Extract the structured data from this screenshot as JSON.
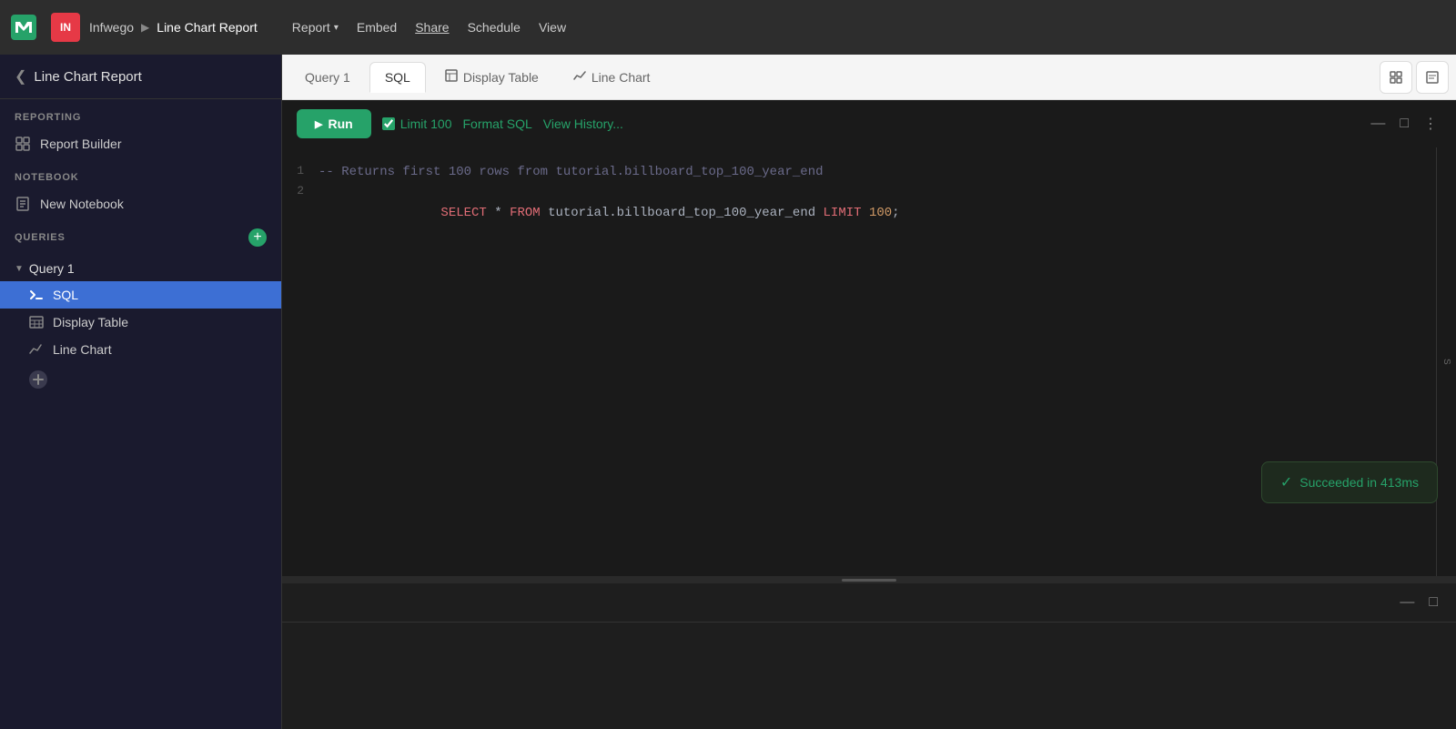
{
  "app": {
    "logo_text": "M",
    "logo_letter": "IN",
    "org_name": "Infwego",
    "breadcrumb_arrow": "▶",
    "report_name": "Line Chart Report"
  },
  "topbar_nav": {
    "report_label": "Report",
    "report_arrow": "▾",
    "embed_label": "Embed",
    "share_label": "Share",
    "schedule_label": "Schedule",
    "view_label": "View"
  },
  "sidebar": {
    "collapse_icon": "❮",
    "title": "Line Chart Report",
    "reporting_label": "REPORTING",
    "report_builder_label": "Report Builder",
    "notebook_label": "NOTEBOOK",
    "new_notebook_label": "New Notebook",
    "queries_label": "QUERIES",
    "add_icon": "+",
    "query1_label": "Query 1",
    "chevron": "▼",
    "sql_label": "SQL",
    "display_table_label": "Display Table",
    "line_chart_label": "Line Chart",
    "add_viz_icon": "+"
  },
  "tabs": {
    "query1_label": "Query 1",
    "sql_label": "SQL",
    "display_table_label": "Display Table",
    "display_table_icon": "⊞",
    "line_chart_label": "Line Chart",
    "line_chart_icon": "📈",
    "viz1_icon": "⊞",
    "viz2_icon": "🖼"
  },
  "sql_toolbar": {
    "run_label": "Run",
    "run_icon": "▶",
    "limit_label": "Limit 100",
    "format_sql_label": "Format SQL",
    "view_history_label": "View History...",
    "minimize_icon": "—",
    "maximize_icon": "□",
    "more_icon": "⋮"
  },
  "code": {
    "line1_num": "1",
    "line1_comment": "-- Returns first 100 rows from tutorial.billboard_top_100_year_end",
    "line2_num": "2",
    "line2_select": "SELECT",
    "line2_star": " * ",
    "line2_from": "FROM",
    "line2_table": " tutorial.billboard_top_100_year_end ",
    "line2_limit": "LIMIT",
    "line2_limit_val": " 100",
    "line2_semi": ";"
  },
  "toast": {
    "check": "✓",
    "message": "Succeeded in 413ms"
  },
  "colors": {
    "green": "#26a269",
    "blue": "#3d6fd4",
    "red": "#e06c75",
    "comment": "#6a6a8a",
    "bg_dark": "#1a1a1a",
    "sidebar_bg": "#1a1a2e"
  }
}
